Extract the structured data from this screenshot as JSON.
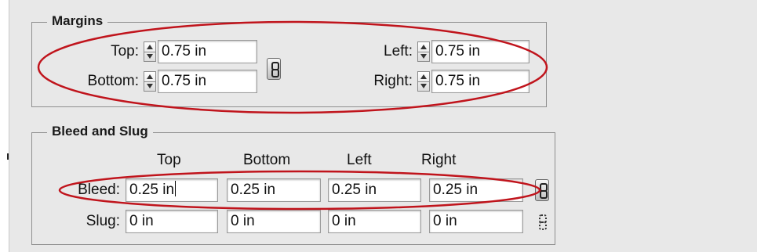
{
  "margins": {
    "legend": "Margins",
    "top_label": "Top:",
    "top_value": "0.75 in",
    "bottom_label": "Bottom:",
    "bottom_value": "0.75 in",
    "left_label": "Left:",
    "left_value": "0.75 in",
    "right_label": "Right:",
    "right_value": "0.75 in",
    "link_icon": "chain-link-icon"
  },
  "bleed_slug": {
    "legend": "Bleed and Slug",
    "columns": [
      "Top",
      "Bottom",
      "Left",
      "Right"
    ],
    "bleed_label": "Bleed:",
    "bleed_values": [
      "0.25 in",
      "0.25 in",
      "0.25 in",
      "0.25 in"
    ],
    "slug_label": "Slug:",
    "slug_values": [
      "0 in",
      "0 in",
      "0 in",
      "0 in"
    ],
    "bleed_link_icon": "chain-link-icon",
    "slug_link_icon": "broken-chain-link-icon"
  },
  "colors": {
    "highlight_ellipse": "#c0141c",
    "panel_background": "#e8e8e8"
  }
}
